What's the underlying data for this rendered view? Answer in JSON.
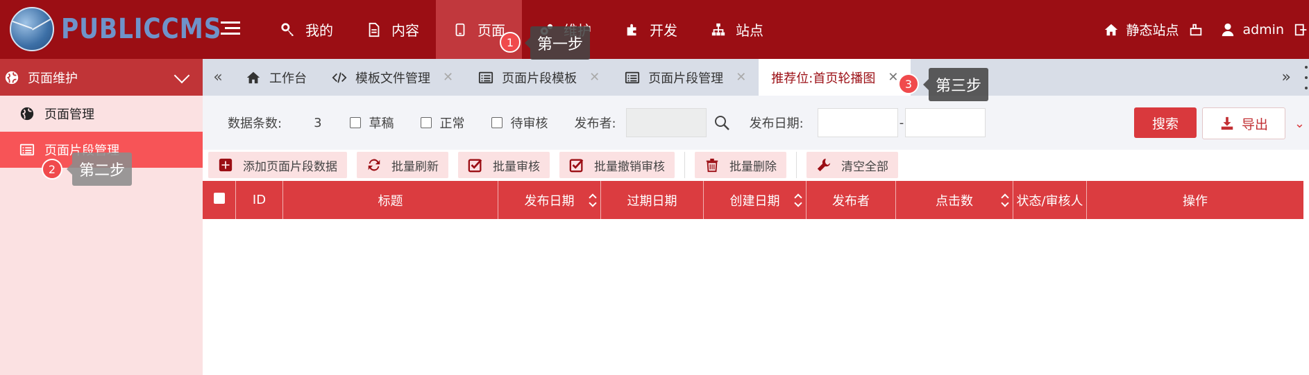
{
  "header": {
    "logo_text": "PUBLICCMS",
    "nav": [
      {
        "label": "我的",
        "icon": "key-icon"
      },
      {
        "label": "内容",
        "icon": "document-icon"
      },
      {
        "label": "页面",
        "icon": "tablet-icon",
        "active": true
      },
      {
        "label": "维护",
        "icon": "gears-icon"
      },
      {
        "label": "开发",
        "icon": "puzzle-icon"
      },
      {
        "label": "站点",
        "icon": "sitemap-icon"
      }
    ],
    "static_site_label": "静态站点",
    "user_label": "admin"
  },
  "sidebar": {
    "section_title": "页面维护",
    "items": [
      {
        "label": "页面管理",
        "icon": "globe-icon"
      },
      {
        "label": "页面片段管理",
        "icon": "list-icon",
        "active": true
      }
    ]
  },
  "tabs": [
    {
      "label": "工作台",
      "icon": "home-icon",
      "closable": false
    },
    {
      "label": "模板文件管理",
      "icon": "code-icon",
      "closable": true
    },
    {
      "label": "页面片段模板",
      "icon": "list-icon",
      "closable": true
    },
    {
      "label": "页面片段管理",
      "icon": "list-icon",
      "closable": true
    },
    {
      "label": "推荐位:首页轮播图",
      "icon": "",
      "closable": true,
      "active": true
    }
  ],
  "search": {
    "count_label": "数据条数:",
    "count_value": "3",
    "checkbox_draft": "草稿",
    "checkbox_normal": "正常",
    "checkbox_pending": "待审核",
    "publisher_label": "发布者:",
    "date_label": "发布日期:",
    "date_separator": "-",
    "search_button": "搜索",
    "export_button": "导出"
  },
  "toolbar": {
    "add": "添加页面片段数据",
    "refresh": "批量刷新",
    "approve": "批量审核",
    "revoke": "批量撤销审核",
    "delete": "批量删除",
    "clear": "清空全部"
  },
  "table": {
    "columns": [
      "ID",
      "标题",
      "发布日期",
      "过期日期",
      "创建日期",
      "发布者",
      "点击数",
      "状态/审核人",
      "操作"
    ]
  },
  "tutorial": {
    "step1_num": "1",
    "step1_text": "第一步",
    "step2_num": "2",
    "step2_text": "第二步",
    "step3_num": "3",
    "step3_text": "第三步"
  },
  "colors": {
    "header_bg": "#9b0e14",
    "active_nav": "#c1383d",
    "sidebar_active": "#f75457",
    "table_header": "#db3c40"
  }
}
